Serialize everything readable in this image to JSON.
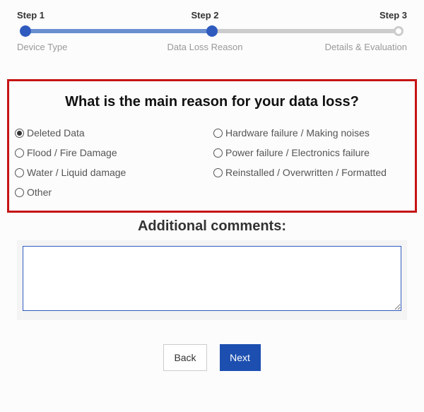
{
  "stepper": {
    "steps": [
      {
        "title": "Step 1",
        "subtitle": "Device Type"
      },
      {
        "title": "Step 2",
        "subtitle": "Data Loss Reason"
      },
      {
        "title": "Step 3",
        "subtitle": "Details & Evaluation"
      }
    ]
  },
  "question": {
    "heading": "What is the main reason for your data loss?",
    "options_left": [
      {
        "label": "Deleted Data",
        "selected": true
      },
      {
        "label": "Flood / Fire Damage",
        "selected": false
      },
      {
        "label": "Water / Liquid damage",
        "selected": false
      },
      {
        "label": "Other",
        "selected": false
      }
    ],
    "options_right": [
      {
        "label": "Hardware failure / Making noises",
        "selected": false
      },
      {
        "label": "Power failure / Electronics failure",
        "selected": false
      },
      {
        "label": "Reinstalled / Overwritten / Formatted",
        "selected": false
      }
    ]
  },
  "comments": {
    "heading": "Additional comments:",
    "value": ""
  },
  "buttons": {
    "back": "Back",
    "next": "Next"
  },
  "colors": {
    "accent": "#1c4fb0",
    "highlight_border": "#c51414"
  }
}
